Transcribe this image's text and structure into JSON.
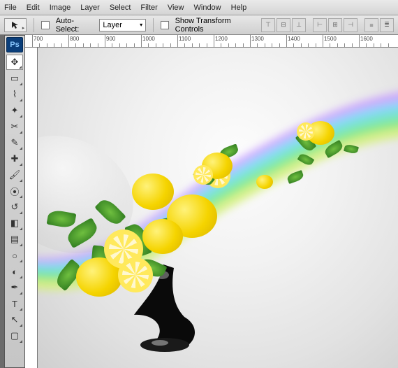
{
  "menu": {
    "file": "File",
    "edit": "Edit",
    "image": "Image",
    "layer": "Layer",
    "select": "Select",
    "filter": "Filter",
    "view": "View",
    "window": "Window",
    "help": "Help"
  },
  "options": {
    "auto_select_label": "Auto-Select:",
    "dropdown_value": "Layer",
    "show_transform_label": "Show Transform Controls"
  },
  "ruler": {
    "marks": [
      "700",
      "800",
      "900",
      "1000",
      "1100",
      "1200",
      "1300",
      "1400",
      "1500",
      "1600"
    ]
  },
  "app_badge": "Ps",
  "tools": [
    {
      "name": "move",
      "glyph": "✥",
      "active": true
    },
    {
      "name": "marquee",
      "glyph": "▭"
    },
    {
      "name": "lasso",
      "glyph": "⌇"
    },
    {
      "name": "wand",
      "glyph": "✦"
    },
    {
      "name": "crop",
      "glyph": "✂"
    },
    {
      "name": "eyedrop",
      "glyph": "✎"
    },
    {
      "name": "heal",
      "glyph": "✚"
    },
    {
      "name": "brush",
      "glyph": "🖌"
    },
    {
      "name": "stamp",
      "glyph": "⦿"
    },
    {
      "name": "history",
      "glyph": "↺"
    },
    {
      "name": "eraser",
      "glyph": "◧"
    },
    {
      "name": "gradient",
      "glyph": "▤"
    },
    {
      "name": "blur",
      "glyph": "○"
    },
    {
      "name": "dodge",
      "glyph": "◐"
    },
    {
      "name": "pen",
      "glyph": "✒"
    },
    {
      "name": "type",
      "glyph": "T"
    },
    {
      "name": "path",
      "glyph": "↖"
    },
    {
      "name": "shape",
      "glyph": "▢"
    }
  ]
}
